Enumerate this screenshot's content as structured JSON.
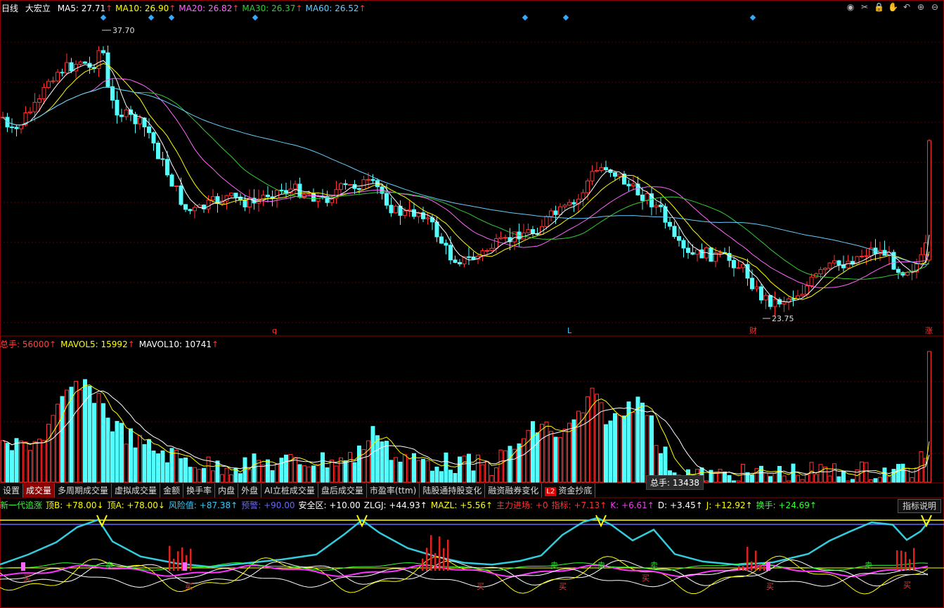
{
  "header": {
    "period": "日线",
    "stock": "大宏立",
    "ma": [
      {
        "label": "MA5: 27.71",
        "color": "#ffffff"
      },
      {
        "label": "MA10: 26.90",
        "color": "#ffff00"
      },
      {
        "label": "MA20: 26.82",
        "color": "#ff66ff"
      },
      {
        "label": "MA30: 26.37",
        "color": "#33cc33"
      },
      {
        "label": "MA60: 26.52",
        "color": "#66ccff"
      }
    ],
    "arrow": "↑"
  },
  "price_marks": {
    "high": "37.70",
    "low": "23.75",
    "q": "q",
    "l": "L",
    "cai": "财",
    "zhang": "涨"
  },
  "volume_header": [
    {
      "label": "总手: 56000",
      "color": "#ff4444"
    },
    {
      "label": "MAVOL5: 15992",
      "color": "#ffff00"
    },
    {
      "label": "MAVOL10: 10741",
      "color": "#ffffff"
    }
  ],
  "tooltip": "总手: 13438",
  "tabs": [
    {
      "label": "设置"
    },
    {
      "label": "成交量",
      "active": true
    },
    {
      "label": "多周期成交量"
    },
    {
      "label": "虚拟成交量"
    },
    {
      "label": "金额"
    },
    {
      "label": "换手率"
    },
    {
      "label": "内盘"
    },
    {
      "label": "外盘"
    },
    {
      "label": "AI立桩成交量"
    },
    {
      "label": "盘后成交量"
    },
    {
      "label": "市盈率(ttm)"
    },
    {
      "label": "陆股通持股变化"
    },
    {
      "label": "融资融券变化"
    },
    {
      "label": "资金抄底",
      "badge": "L2"
    }
  ],
  "indicator_header": [
    {
      "label": "新一代追涨",
      "color": "#33ff33"
    },
    {
      "label": "顶B: +78.00↓",
      "color": "#ffff00"
    },
    {
      "label": "顶A: +78.00↓",
      "color": "#ffff00"
    },
    {
      "label": "风险值: +87.38↑",
      "color": "#33ccff"
    },
    {
      "label": "预警: +90.00",
      "color": "#6666ff"
    },
    {
      "label": "安全区: +10.00",
      "color": "#ffffff"
    },
    {
      "label": "ZLGJ: +44.93↑",
      "color": "#ffffff"
    },
    {
      "label": "MAZL: +5.56↑",
      "color": "#ffff00"
    },
    {
      "label": "主力进场: +0",
      "color": "#ff3333"
    },
    {
      "label": "指标: +7.13↑",
      "color": "#ff3333"
    },
    {
      "label": "K: +6.61↑",
      "color": "#ff33ff"
    },
    {
      "label": "D: +3.45↑",
      "color": "#ffffff"
    },
    {
      "label": "J: +12.92↑",
      "color": "#ffff00"
    },
    {
      "label": "换手: +24.69↑",
      "color": "#33ff33"
    }
  ],
  "indicator_button": "指标说明",
  "signals": {
    "buy": "买",
    "sell": "卖"
  },
  "toolbar_icons": [
    "eye-icon",
    "scissors-icon",
    "lock-icon",
    "hand-icon",
    "undo-icon",
    "zoom-in-icon",
    "zoom-out-icon"
  ],
  "toolbar_glyphs": [
    "◉",
    "✂",
    "🔒",
    "✋",
    "↶",
    "⊕",
    "⊖"
  ]
}
